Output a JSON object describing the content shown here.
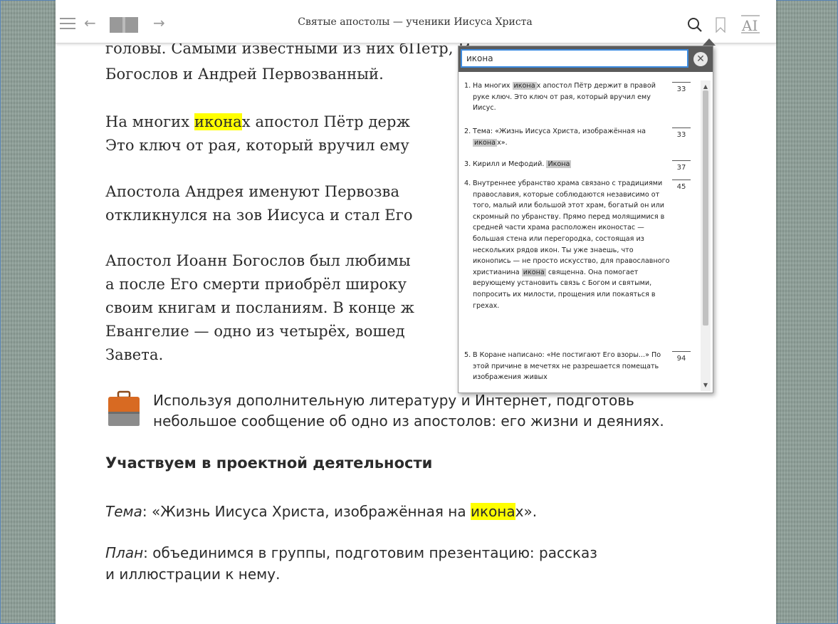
{
  "toolbar": {
    "title": "Святые апостолы — ученики Иисуса Христа",
    "font_icon_label": "AI"
  },
  "text": {
    "p1_l1": "головы. Самыми известными из них б",
    "p1_l1_tail": "Пётр, И",
    "p1_l2": "Богослов и Андрей Первозванный.",
    "p2_l1_pre": "На многих ",
    "p2_l1_hl": "икона",
    "p2_l1_post": "х апостол Пётр держ",
    "p2_l2": "Это ключ от рая, который вручил ему",
    "p3_l1": "Апостола Андрея именуют Первозва",
    "p3_l2": "откликнулся на зов Иисуса и стал Его",
    "p4_l1": "Апостол Иоанн Богослов был любимы",
    "p4_l2": "а после Его смерти приобрёл широку",
    "p4_l3": "своим книгам и посланиям. В конце ж",
    "p4_l4": "Евангелие — одно из четырёх, вошед",
    "p4_l5": "Завета.",
    "task_l1": "Используя дополнительную литературу и Интернет, подготовь",
    "task_l2": "небольшое сообщение об одно из апостолов: его жизни и деяниях.",
    "heading": "Участвуем в проектной деятельности",
    "topic_label": "Тема",
    "topic_pre": ": «Жизнь Иисуса Христа, изображённая на ",
    "topic_hl": "икона",
    "topic_post": "х».",
    "plan_label": "План",
    "plan_l1": ": объединимся в группы, подготовим презентацию: рассказ",
    "plan_l2": "и иллюстрации к нему."
  },
  "search": {
    "query": "икона",
    "clear_label": "✕",
    "results": [
      {
        "num": "1.",
        "pre": "На многих ",
        "hl": "икона",
        "post": "х апостол Пётр держит в правой руке ключ. Это ключ от рая, который вручил ему Иисус.",
        "page": "33"
      },
      {
        "num": "2.",
        "pre": "Тема: «Жизнь Иисуса Христа, изображённая на ",
        "hl": "икона",
        "post": "х».",
        "page": "33"
      },
      {
        "num": "3.",
        "pre": "Кирилл и Мефодий. ",
        "hl": "Икона",
        "post": "",
        "page": "37"
      },
      {
        "num": "4.",
        "pre": "Внутреннее убранство храма связано с традициями православия, которые соблюдаются независимо от того, малый или большой этот храм, богатый он или скромный по убранству. Прямо перед молящимися в средней части храма расположен иконостас — большая стена или перегородка, состоящая из нескольких рядов икон. Ты уже знаешь, что иконопись — не просто искусство, для православного христианина ",
        "hl": "икона",
        "post": " священна. Она помогает верующему установить связь с Богом и святыми, попросить их милости, прощения или покаяться в грехах.",
        "page": "45"
      },
      {
        "num": "5.",
        "pre": "В Коране написано: «Не постигают Его взоры...» По этой причине в мечетях не разрешается помещать изображения живых",
        "hl": "",
        "post": "",
        "page": "94"
      }
    ]
  },
  "colors": {
    "highlight": "#ffff00",
    "result_highlight": "#c9c9c9",
    "background": "#8fa099",
    "search_border": "#3d8be0"
  }
}
